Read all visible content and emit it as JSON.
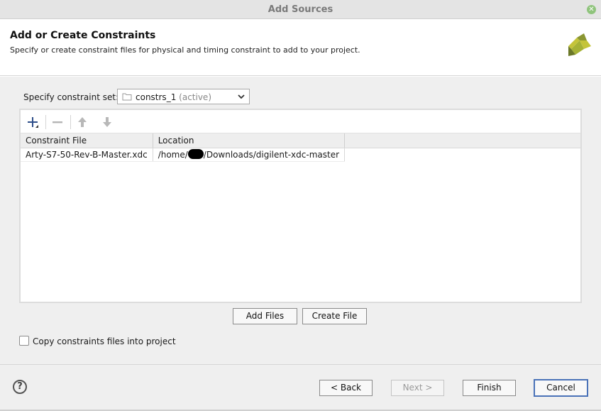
{
  "window": {
    "title": "Add Sources"
  },
  "header": {
    "title": "Add or Create Constraints",
    "subtitle": "Specify or create constraint files for physical and timing constraint to add to your project."
  },
  "constraint_set": {
    "label": "Specify constraint set:",
    "value": "constrs_1",
    "state": "(active)"
  },
  "table": {
    "columns": [
      "Constraint File",
      "Location"
    ],
    "rows": [
      {
        "file": "Arty-S7-50-Rev-B-Master.xdc",
        "location_prefix": "/home/",
        "location_suffix": "/Downloads/digilent-xdc-master"
      }
    ]
  },
  "actions": {
    "add_files": "Add Files",
    "create_file": "Create File"
  },
  "copy_option": {
    "label": "Copy constraints files into project",
    "checked": false
  },
  "footer": {
    "help": "?",
    "back": "< Back",
    "next": "Next >",
    "finish": "Finish",
    "cancel": "Cancel"
  },
  "colors": {
    "accent": "#4a72b8",
    "logo_light": "#c4c43a",
    "logo_dark": "#7d8a2a"
  }
}
